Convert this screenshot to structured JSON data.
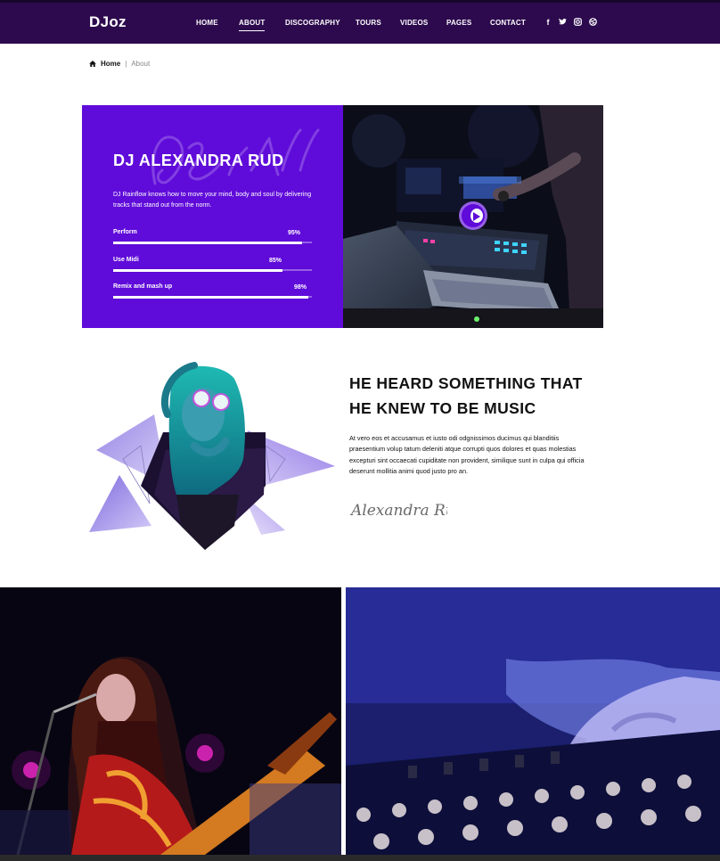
{
  "header": {
    "logo": "DJoz",
    "nav": [
      "HOME",
      "ABOUT",
      "DISCOGRAPHY",
      "TOURS",
      "VIDEOS",
      "PAGES",
      "CONTACT"
    ],
    "active_nav": "ABOUT",
    "social_icons": [
      "facebook-icon",
      "twitter-icon",
      "instagram-icon",
      "dribbble-icon"
    ]
  },
  "breadcrumb": {
    "home": "Home",
    "separator": "|",
    "current": "About"
  },
  "profile": {
    "name": "DJ ALEXANDRA RUD",
    "description": "DJ Rainflow knows how to move your mind, body and soul by delivering tracks that stand out from the norm.",
    "skills": [
      {
        "label": "Perform",
        "percent_text": "95%",
        "value": 95
      },
      {
        "label": "Use Midi",
        "percent_text": "85%",
        "value": 85
      },
      {
        "label": "Remix and mash up",
        "percent_text": "98%",
        "value": 98
      }
    ]
  },
  "about": {
    "heading": "HE HEARD SOMETHING THAT HE KNEW TO BE MUSIC",
    "text": "At vero eos et accusamus et iusto odi odgnissimos ducimus qui blanditiis praesentium volup tatum deleniti atque corrupti quos dolores et quas molestias excepturi sint occaecati cupiditate non provident, similique sunt in culpa qui officia deserunt mollitia animi quod justo pro an.",
    "signature": "Alexandra Rud"
  },
  "colors": {
    "header_bg": "#2d0a4e",
    "accent_purple": "#5f0bd9",
    "text_dark": "#111111"
  }
}
